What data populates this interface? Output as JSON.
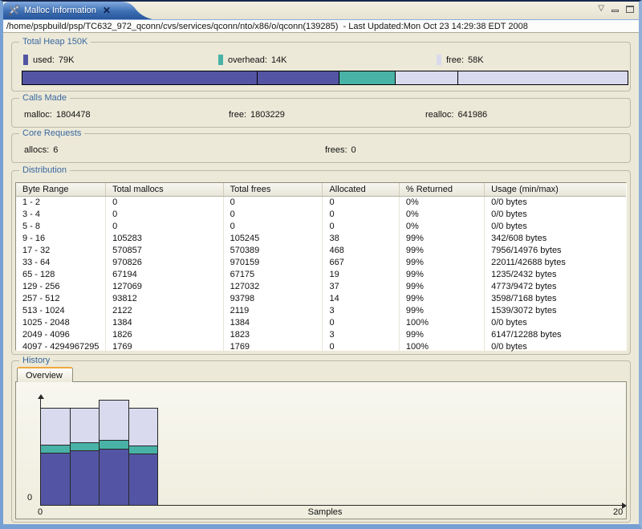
{
  "window": {
    "tab": {
      "title": "Malloc Information"
    },
    "icons": {
      "close": "✕",
      "view_menu": "▽"
    },
    "path_bar": "/home/pspbuild/psp/TC632_972_qconn/cvs/services/qconn/nto/x86/o/qconn(139285)  - Last Updated:Mon Oct 23 14:29:38 EDT 2008"
  },
  "colors": {
    "used": "#5355a4",
    "overhead": "#49b2a6",
    "free": "#d9daee"
  },
  "total_heap": {
    "title": "Total Heap 150K",
    "legend": [
      {
        "name": "used",
        "label": "used:",
        "value": "79K",
        "kb": 79
      },
      {
        "name": "overhead",
        "label": "overhead:",
        "value": "14K",
        "kb": 14
      },
      {
        "name": "free",
        "label": "free:",
        "value": "58K",
        "kb": 58
      }
    ],
    "dividers_pct": [
      38.7,
      71.9
    ]
  },
  "calls_made": {
    "title": "Calls Made",
    "fields": [
      {
        "label": "malloc:",
        "value": "1804478"
      },
      {
        "label": "free:",
        "value": "1803229"
      },
      {
        "label": "realloc:",
        "value": "641986"
      }
    ]
  },
  "core_requests": {
    "title": "Core Requests",
    "fields": [
      {
        "label": "allocs:",
        "value": "6"
      },
      {
        "label": "frees:",
        "value": "0"
      }
    ]
  },
  "distribution": {
    "title": "Distribution",
    "columns": [
      "Byte Range",
      "Total mallocs",
      "Total frees",
      "Allocated",
      "% Returned",
      "Usage (min/max)"
    ],
    "rows": [
      [
        "1 - 2",
        "0",
        "0",
        "0",
        "0%",
        "0/0 bytes"
      ],
      [
        "3 - 4",
        "0",
        "0",
        "0",
        "0%",
        "0/0 bytes"
      ],
      [
        "5 - 8",
        "0",
        "0",
        "0",
        "0%",
        "0/0 bytes"
      ],
      [
        "9 - 16",
        "105283",
        "105245",
        "38",
        "99%",
        "342/608 bytes"
      ],
      [
        "17 - 32",
        "570857",
        "570389",
        "468",
        "99%",
        "7956/14976 bytes"
      ],
      [
        "33 - 64",
        "970826",
        "970159",
        "667",
        "99%",
        "22011/42688 bytes"
      ],
      [
        "65 - 128",
        "67194",
        "67175",
        "19",
        "99%",
        "1235/2432 bytes"
      ],
      [
        "129 - 256",
        "127069",
        "127032",
        "37",
        "99%",
        "4773/9472 bytes"
      ],
      [
        "257 - 512",
        "93812",
        "93798",
        "14",
        "99%",
        "3598/7168 bytes"
      ],
      [
        "513 - 1024",
        "2122",
        "2119",
        "3",
        "99%",
        "1539/3072 bytes"
      ],
      [
        "1025 - 2048",
        "1384",
        "1384",
        "0",
        "100%",
        "0/0 bytes"
      ],
      [
        "2049 - 4096",
        "1826",
        "1823",
        "3",
        "99%",
        "6147/12288 bytes"
      ],
      [
        "4097 - 4294967295",
        "1769",
        "1769",
        "0",
        "100%",
        "0/0 bytes"
      ]
    ]
  },
  "history": {
    "title": "History",
    "tab": "Overview"
  },
  "chart_data": {
    "type": "bar",
    "stacked": true,
    "x": [
      1,
      2,
      3,
      4
    ],
    "series": [
      {
        "name": "used",
        "values": [
          80,
          84,
          86,
          79
        ]
      },
      {
        "name": "overhead",
        "values": [
          12,
          12,
          14,
          12
        ]
      },
      {
        "name": "free",
        "values": [
          57,
          54,
          62,
          59
        ]
      }
    ],
    "units": "K",
    "xlabel": "Samples",
    "xlim": [
      0,
      20
    ],
    "x_tick_labels": [
      "0",
      "20"
    ],
    "y_origin_label": "0",
    "legend_position": "none",
    "grid": false
  }
}
